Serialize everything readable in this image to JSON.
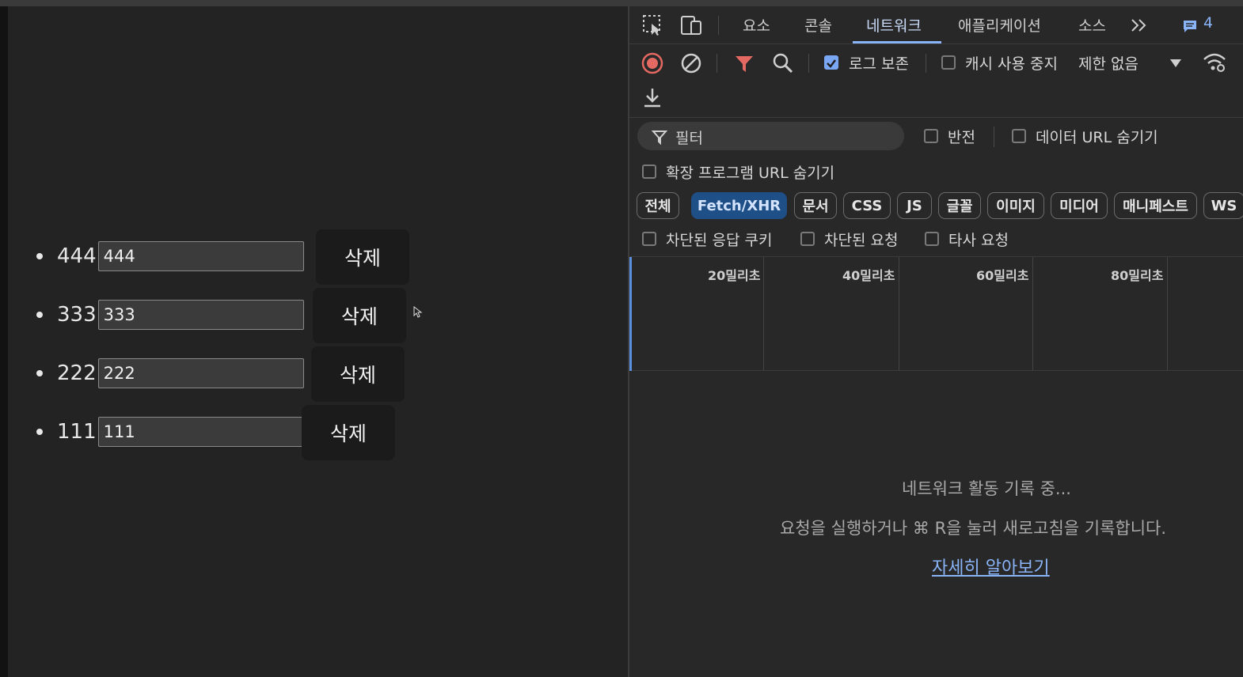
{
  "page": {
    "items": [
      {
        "text": "444",
        "value": "444",
        "delete_label": "삭제"
      },
      {
        "text": "333",
        "value": "333",
        "delete_label": "삭제"
      },
      {
        "text": "222",
        "value": "222",
        "delete_label": "삭제"
      },
      {
        "text": "111",
        "value": "111",
        "delete_label": "삭제"
      }
    ]
  },
  "devtools": {
    "tabs": [
      "요소",
      "콘솔",
      "네트워크",
      "애플리케이션",
      "소스"
    ],
    "active_tab": "네트워크",
    "issue_count": "4",
    "toolbar": {
      "preserve_log_label": "로그 보존",
      "preserve_log_checked": true,
      "disable_cache_label": "캐시 사용 중지",
      "disable_cache_checked": false,
      "throttling_value": "제한 없음"
    },
    "filter": {
      "placeholder": "필터",
      "invert_label": "반전",
      "hide_data_urls_label": "데이터 URL 숨기기",
      "hide_extension_urls_label": "확장 프로그램 URL 숨기기"
    },
    "type_chips": [
      "전체",
      "Fetch/XHR",
      "문서",
      "CSS",
      "JS",
      "글꼴",
      "이미지",
      "미디어",
      "매니페스트",
      "WS"
    ],
    "active_chip": "Fetch/XHR",
    "more_filters": {
      "blocked_cookies_label": "차단된 응답 쿠키",
      "blocked_requests_label": "차단된 요청",
      "third_party_label": "타사 요청"
    },
    "timeline_ticks": [
      "20밀리초",
      "40밀리초",
      "60밀리초",
      "80밀리초"
    ],
    "empty_state": {
      "line1": "네트워크 활동 기록 중...",
      "line2": "요청을 실행하거나 ⌘ R을 눌러 새로고침을 기록합니다.",
      "link": "자세히 알아보기"
    },
    "colors": {
      "accent": "#8ab4f8",
      "record_red": "#e46962",
      "filter_red": "#e46962",
      "chip_active_bg": "#1f4f87"
    }
  }
}
